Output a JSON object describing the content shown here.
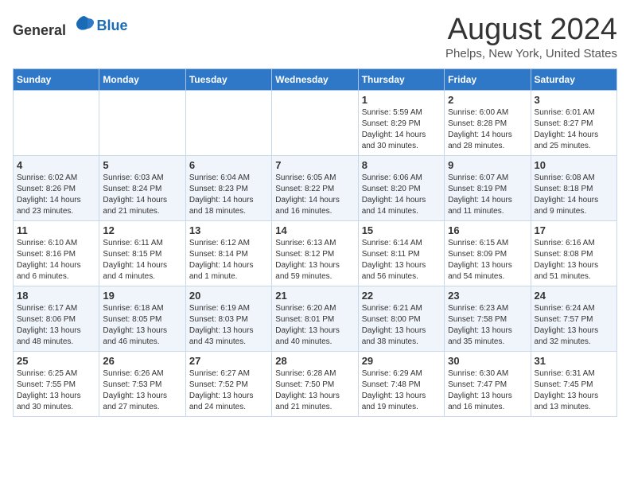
{
  "logo": {
    "general": "General",
    "blue": "Blue"
  },
  "title": "August 2024",
  "location": "Phelps, New York, United States",
  "weekdays": [
    "Sunday",
    "Monday",
    "Tuesday",
    "Wednesday",
    "Thursday",
    "Friday",
    "Saturday"
  ],
  "weeks": [
    [
      {
        "day": "",
        "info": ""
      },
      {
        "day": "",
        "info": ""
      },
      {
        "day": "",
        "info": ""
      },
      {
        "day": "",
        "info": ""
      },
      {
        "day": "1",
        "info": "Sunrise: 5:59 AM\nSunset: 8:29 PM\nDaylight: 14 hours\nand 30 minutes."
      },
      {
        "day": "2",
        "info": "Sunrise: 6:00 AM\nSunset: 8:28 PM\nDaylight: 14 hours\nand 28 minutes."
      },
      {
        "day": "3",
        "info": "Sunrise: 6:01 AM\nSunset: 8:27 PM\nDaylight: 14 hours\nand 25 minutes."
      }
    ],
    [
      {
        "day": "4",
        "info": "Sunrise: 6:02 AM\nSunset: 8:26 PM\nDaylight: 14 hours\nand 23 minutes."
      },
      {
        "day": "5",
        "info": "Sunrise: 6:03 AM\nSunset: 8:24 PM\nDaylight: 14 hours\nand 21 minutes."
      },
      {
        "day": "6",
        "info": "Sunrise: 6:04 AM\nSunset: 8:23 PM\nDaylight: 14 hours\nand 18 minutes."
      },
      {
        "day": "7",
        "info": "Sunrise: 6:05 AM\nSunset: 8:22 PM\nDaylight: 14 hours\nand 16 minutes."
      },
      {
        "day": "8",
        "info": "Sunrise: 6:06 AM\nSunset: 8:20 PM\nDaylight: 14 hours\nand 14 minutes."
      },
      {
        "day": "9",
        "info": "Sunrise: 6:07 AM\nSunset: 8:19 PM\nDaylight: 14 hours\nand 11 minutes."
      },
      {
        "day": "10",
        "info": "Sunrise: 6:08 AM\nSunset: 8:18 PM\nDaylight: 14 hours\nand 9 minutes."
      }
    ],
    [
      {
        "day": "11",
        "info": "Sunrise: 6:10 AM\nSunset: 8:16 PM\nDaylight: 14 hours\nand 6 minutes."
      },
      {
        "day": "12",
        "info": "Sunrise: 6:11 AM\nSunset: 8:15 PM\nDaylight: 14 hours\nand 4 minutes."
      },
      {
        "day": "13",
        "info": "Sunrise: 6:12 AM\nSunset: 8:14 PM\nDaylight: 14 hours\nand 1 minute."
      },
      {
        "day": "14",
        "info": "Sunrise: 6:13 AM\nSunset: 8:12 PM\nDaylight: 13 hours\nand 59 minutes."
      },
      {
        "day": "15",
        "info": "Sunrise: 6:14 AM\nSunset: 8:11 PM\nDaylight: 13 hours\nand 56 minutes."
      },
      {
        "day": "16",
        "info": "Sunrise: 6:15 AM\nSunset: 8:09 PM\nDaylight: 13 hours\nand 54 minutes."
      },
      {
        "day": "17",
        "info": "Sunrise: 6:16 AM\nSunset: 8:08 PM\nDaylight: 13 hours\nand 51 minutes."
      }
    ],
    [
      {
        "day": "18",
        "info": "Sunrise: 6:17 AM\nSunset: 8:06 PM\nDaylight: 13 hours\nand 48 minutes."
      },
      {
        "day": "19",
        "info": "Sunrise: 6:18 AM\nSunset: 8:05 PM\nDaylight: 13 hours\nand 46 minutes."
      },
      {
        "day": "20",
        "info": "Sunrise: 6:19 AM\nSunset: 8:03 PM\nDaylight: 13 hours\nand 43 minutes."
      },
      {
        "day": "21",
        "info": "Sunrise: 6:20 AM\nSunset: 8:01 PM\nDaylight: 13 hours\nand 40 minutes."
      },
      {
        "day": "22",
        "info": "Sunrise: 6:21 AM\nSunset: 8:00 PM\nDaylight: 13 hours\nand 38 minutes."
      },
      {
        "day": "23",
        "info": "Sunrise: 6:23 AM\nSunset: 7:58 PM\nDaylight: 13 hours\nand 35 minutes."
      },
      {
        "day": "24",
        "info": "Sunrise: 6:24 AM\nSunset: 7:57 PM\nDaylight: 13 hours\nand 32 minutes."
      }
    ],
    [
      {
        "day": "25",
        "info": "Sunrise: 6:25 AM\nSunset: 7:55 PM\nDaylight: 13 hours\nand 30 minutes."
      },
      {
        "day": "26",
        "info": "Sunrise: 6:26 AM\nSunset: 7:53 PM\nDaylight: 13 hours\nand 27 minutes."
      },
      {
        "day": "27",
        "info": "Sunrise: 6:27 AM\nSunset: 7:52 PM\nDaylight: 13 hours\nand 24 minutes."
      },
      {
        "day": "28",
        "info": "Sunrise: 6:28 AM\nSunset: 7:50 PM\nDaylight: 13 hours\nand 21 minutes."
      },
      {
        "day": "29",
        "info": "Sunrise: 6:29 AM\nSunset: 7:48 PM\nDaylight: 13 hours\nand 19 minutes."
      },
      {
        "day": "30",
        "info": "Sunrise: 6:30 AM\nSunset: 7:47 PM\nDaylight: 13 hours\nand 16 minutes."
      },
      {
        "day": "31",
        "info": "Sunrise: 6:31 AM\nSunset: 7:45 PM\nDaylight: 13 hours\nand 13 minutes."
      }
    ]
  ]
}
